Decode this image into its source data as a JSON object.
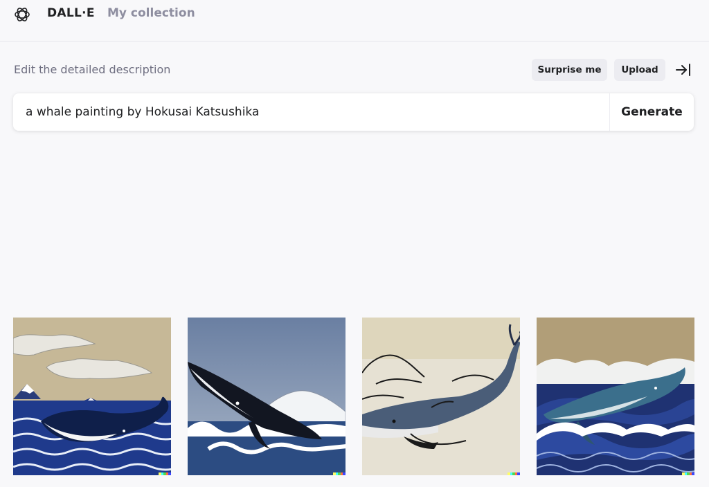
{
  "header": {
    "brand": "DALL·E",
    "nav_link": "My collection"
  },
  "prompt_section": {
    "label": "Edit the detailed description",
    "surprise_label": "Surprise me",
    "upload_label": "Upload",
    "prompt_value": "a whale painting by Hokusai Katsushika",
    "generate_label": "Generate"
  },
  "gallery": {
    "images": [
      "ukiyo-e whale with Mount Fuji and clouds",
      "breaching whale over waves with snowy mountain",
      "ink sketch whale with mountain outlines",
      "whale riding large blue waves"
    ]
  },
  "colors": {
    "accent_dark": "#202123",
    "muted": "#8e8ea0",
    "chip_bg": "#ececf1",
    "signature": [
      "#ffff66",
      "#42ffff",
      "#51da4c",
      "#ff6e3c",
      "#3c46ff"
    ]
  }
}
